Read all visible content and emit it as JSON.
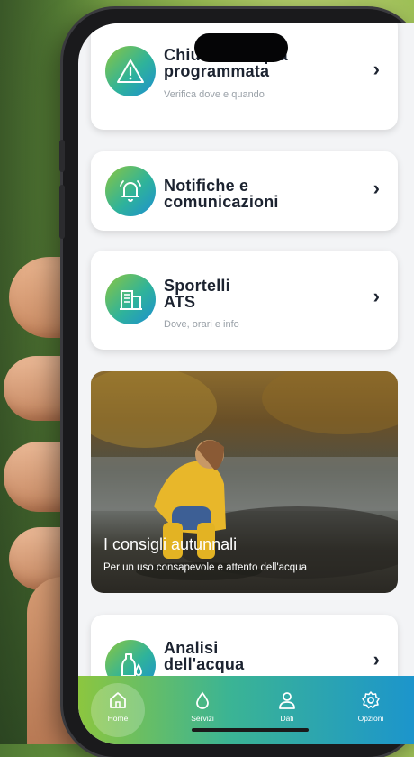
{
  "cards": [
    {
      "title_line1": "Chiusura acqua",
      "title_line2": "programmata",
      "subtitle": "Verifica dove e quando",
      "icon": "warning-icon"
    },
    {
      "title_line1": "Notifiche e",
      "title_line2": "comunicazioni",
      "subtitle": "",
      "icon": "bell-icon"
    },
    {
      "title_line1": "Sportelli",
      "title_line2": "ATS",
      "subtitle": "Dove, orari e info",
      "icon": "office-building-icon"
    },
    {
      "title_line1": "Analisi",
      "title_line2": "dell'acqua",
      "subtitle": "",
      "icon": "water-bottle-icon"
    }
  ],
  "promo": {
    "title": "I consigli autunnali",
    "subtitle": "Per un uso consapevole e attento dell'acqua"
  },
  "tabbar": {
    "items": [
      {
        "label": "Home",
        "icon": "home-icon",
        "active": true
      },
      {
        "label": "Servizi",
        "icon": "water-drop-icon",
        "active": false
      },
      {
        "label": "Dati",
        "icon": "user-icon",
        "active": false
      },
      {
        "label": "Opzioni",
        "icon": "gear-icon",
        "active": false
      }
    ]
  },
  "colors": {
    "gradient_start": "#8cc63f",
    "gradient_mid": "#2fb39a",
    "gradient_end": "#1d8fd1",
    "title_text": "#1c2330",
    "subtitle_text": "#9aa1a8"
  }
}
